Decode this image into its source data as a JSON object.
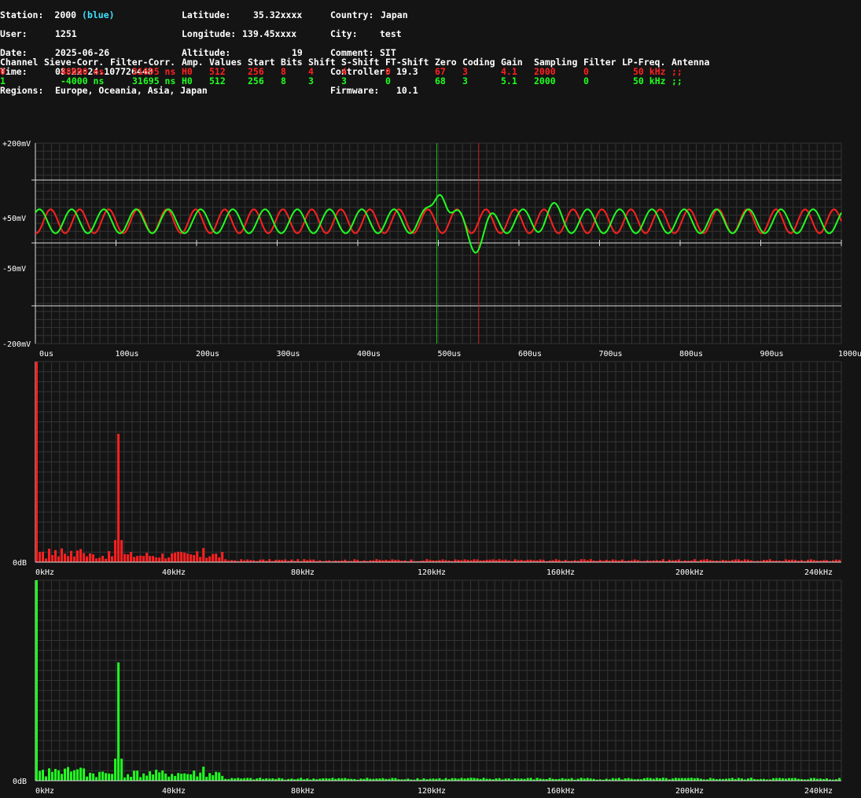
{
  "station": {
    "station_label": "Station:",
    "station_value": "2000",
    "station_color": "(blue)",
    "user_label": "User:",
    "user_value": "1251",
    "date_label": "Date:",
    "date_value": "2025-06-26",
    "time_label": "Time:",
    "time_value": "08:22:24.107726448",
    "regions_label": "Regions:",
    "regions_value": "Europe, Oceania, Asia, Japan",
    "latitude_label": "Latitude:",
    "latitude_value": "35.32xxxx",
    "longitude_label": "Longitude:",
    "longitude_value": "139.45xxxx",
    "altitude_label": "Altitude:",
    "altitude_value": "19",
    "country_label": "Country:",
    "country_value": "Japan",
    "city_label": "City:",
    "city_value": "test",
    "comment_label": "Comment:",
    "comment_value": "SIT",
    "controller_label": "Controller:",
    "controller_value": "19.3",
    "firmware_label": "Firmware:",
    "firmware_value": "10.1"
  },
  "channel_table": {
    "headers": [
      "Channel",
      "Sieve-Corr.",
      "Filter-Corr.",
      "Amp.",
      "Values",
      "Start",
      "Bits",
      "Shift",
      "S-Shift",
      "FT-Shift",
      "Zero",
      "Coding",
      "Gain",
      "Sampling",
      "Filter",
      "LP-Freq.",
      "Antenna"
    ],
    "rows": [
      {
        "color": "#ff2020",
        "cells": [
          "0",
          "48000 ns",
          "31695 ns",
          "H0",
          "512",
          "256",
          "8",
          "4",
          "4",
          "0",
          "67",
          "3",
          "4.1",
          "2000",
          "0",
          "50 kHz",
          ";;"
        ]
      },
      {
        "color": "#20ff20",
        "cells": [
          "1",
          "-4000 ns",
          "31695 ns",
          "H0",
          "512",
          "256",
          "8",
          "3",
          "3",
          "0",
          "68",
          "3",
          "5.1",
          "2000",
          "0",
          "50 kHz",
          ";;"
        ]
      }
    ]
  },
  "waveform": {
    "y_labels": [
      "+200mV",
      "+50mV",
      "-50mV",
      "-200mV"
    ],
    "x_labels": [
      "0us",
      "100us",
      "200us",
      "300us",
      "400us",
      "500us",
      "600us",
      "700us",
      "800us",
      "900us",
      "1000us"
    ]
  },
  "spectrum_red": {
    "y_label": "0dB",
    "x_labels": [
      "0kHz",
      "40kHz",
      "80kHz",
      "120kHz",
      "160kHz",
      "200kHz",
      "240kHz"
    ]
  },
  "spectrum_green": {
    "y_label": "0dB",
    "x_labels": [
      "0kHz",
      "40kHz",
      "80kHz",
      "120kHz",
      "160kHz",
      "200kHz",
      "240kHz"
    ]
  },
  "chart_data": [
    {
      "type": "line",
      "xlabel": "",
      "ylabel": "",
      "xlim": [
        0,
        1000
      ],
      "ylim": [
        -200,
        200
      ],
      "series": [
        {
          "color": "#ff2020",
          "signal_center_mV": 44,
          "amplitude_mV": 24,
          "period_us": 36,
          "marker_us": 550
        },
        {
          "color": "#20ff20",
          "signal_center_mV": 44,
          "amplitude_mV": 24,
          "period_us": 40,
          "marker_us": 498,
          "peak_mV": 113,
          "peak_us": 503,
          "trough_mV": 20,
          "trough_us": 548
        }
      ]
    },
    {
      "type": "bar",
      "series": [
        {
          "color": "#ff2020",
          "peak_khz": [
            0,
            26
          ],
          "peak_relative": [
            1.0,
            0.64
          ]
        }
      ],
      "xlim": [
        0,
        250
      ]
    },
    {
      "type": "bar",
      "series": [
        {
          "color": "#20ff20",
          "peak_khz": [
            0,
            26
          ],
          "peak_relative": [
            1.0,
            0.59
          ]
        }
      ],
      "xlim": [
        0,
        250
      ]
    }
  ],
  "colors": {
    "background": "#141414",
    "grid": "#3a3a3a",
    "red": "#ff2020",
    "green": "#20ff20",
    "cyan": "#40e0ff"
  }
}
